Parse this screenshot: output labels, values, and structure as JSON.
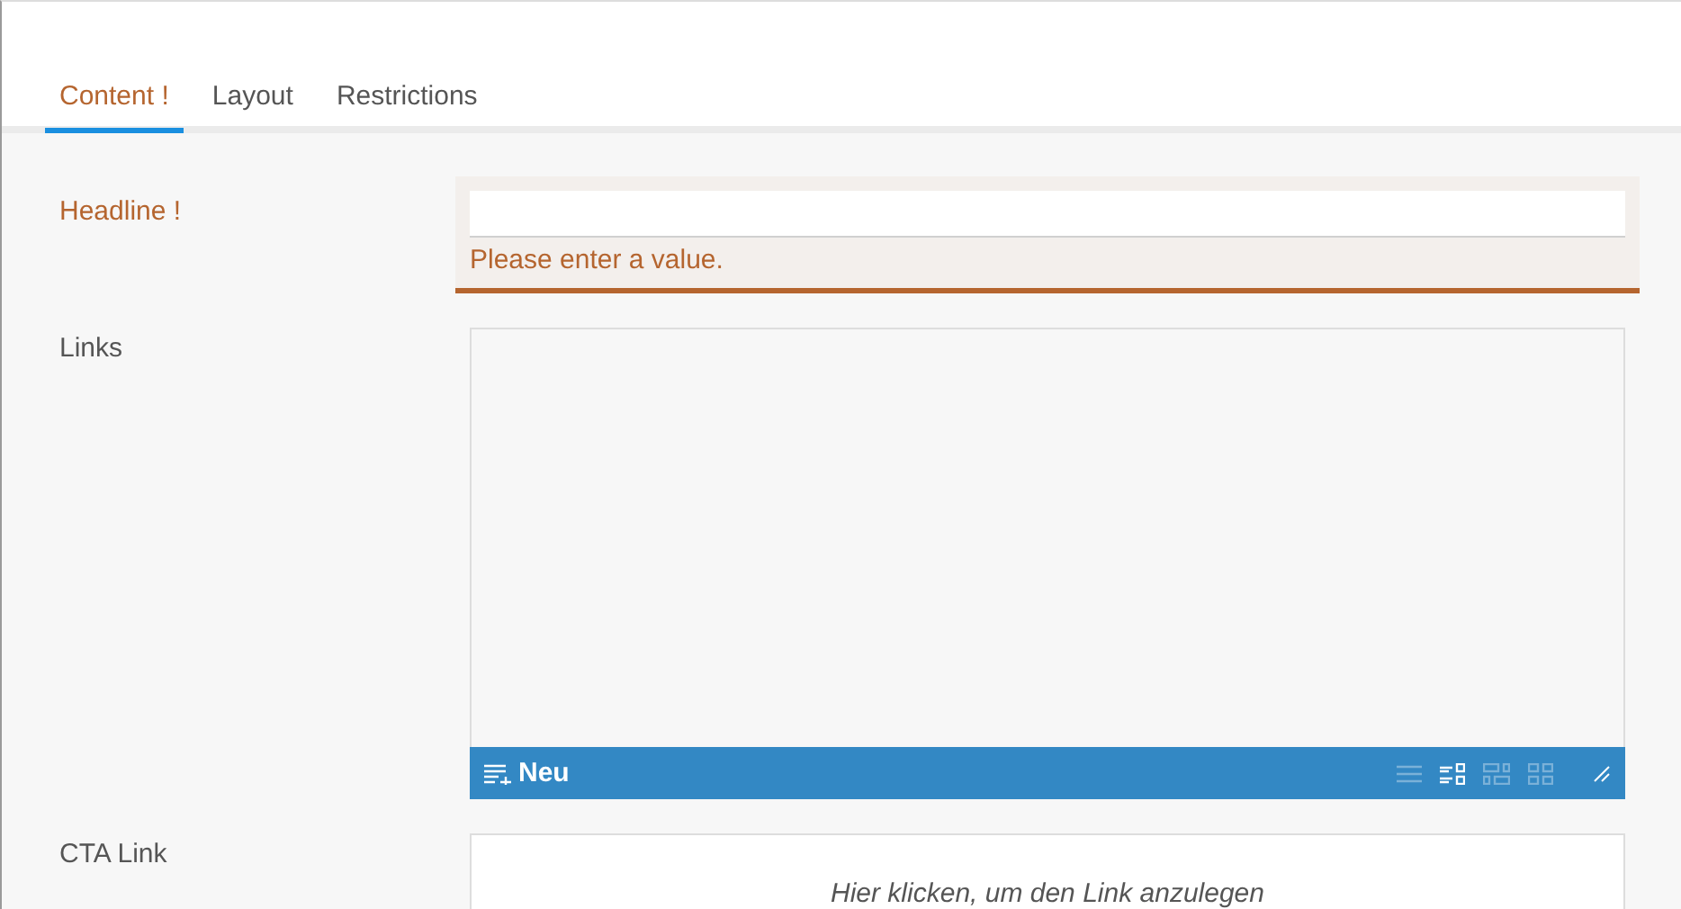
{
  "tabs": [
    {
      "label": "Content",
      "flag": "!",
      "selected": true,
      "invalid": true
    },
    {
      "label": "Layout",
      "selected": false,
      "invalid": false
    },
    {
      "label": "Restrictions",
      "selected": false,
      "invalid": false
    }
  ],
  "fields": [
    {
      "kind": "text",
      "label": "Headline",
      "flag": "!",
      "invalid": true,
      "error": "Please enter a value."
    },
    {
      "kind": "list",
      "label": "Links",
      "invalid": false,
      "add_label": "Neu",
      "view_modes": [
        {
          "kind": "list",
          "selected": false
        },
        {
          "kind": "detail",
          "selected": true
        },
        {
          "kind": "tiles",
          "selected": false
        },
        {
          "kind": "grid",
          "selected": false
        }
      ]
    },
    {
      "kind": "link",
      "label": "CTA Link",
      "invalid": false,
      "placeholder": "Hier klicken, um den Link anzulegen"
    }
  ]
}
